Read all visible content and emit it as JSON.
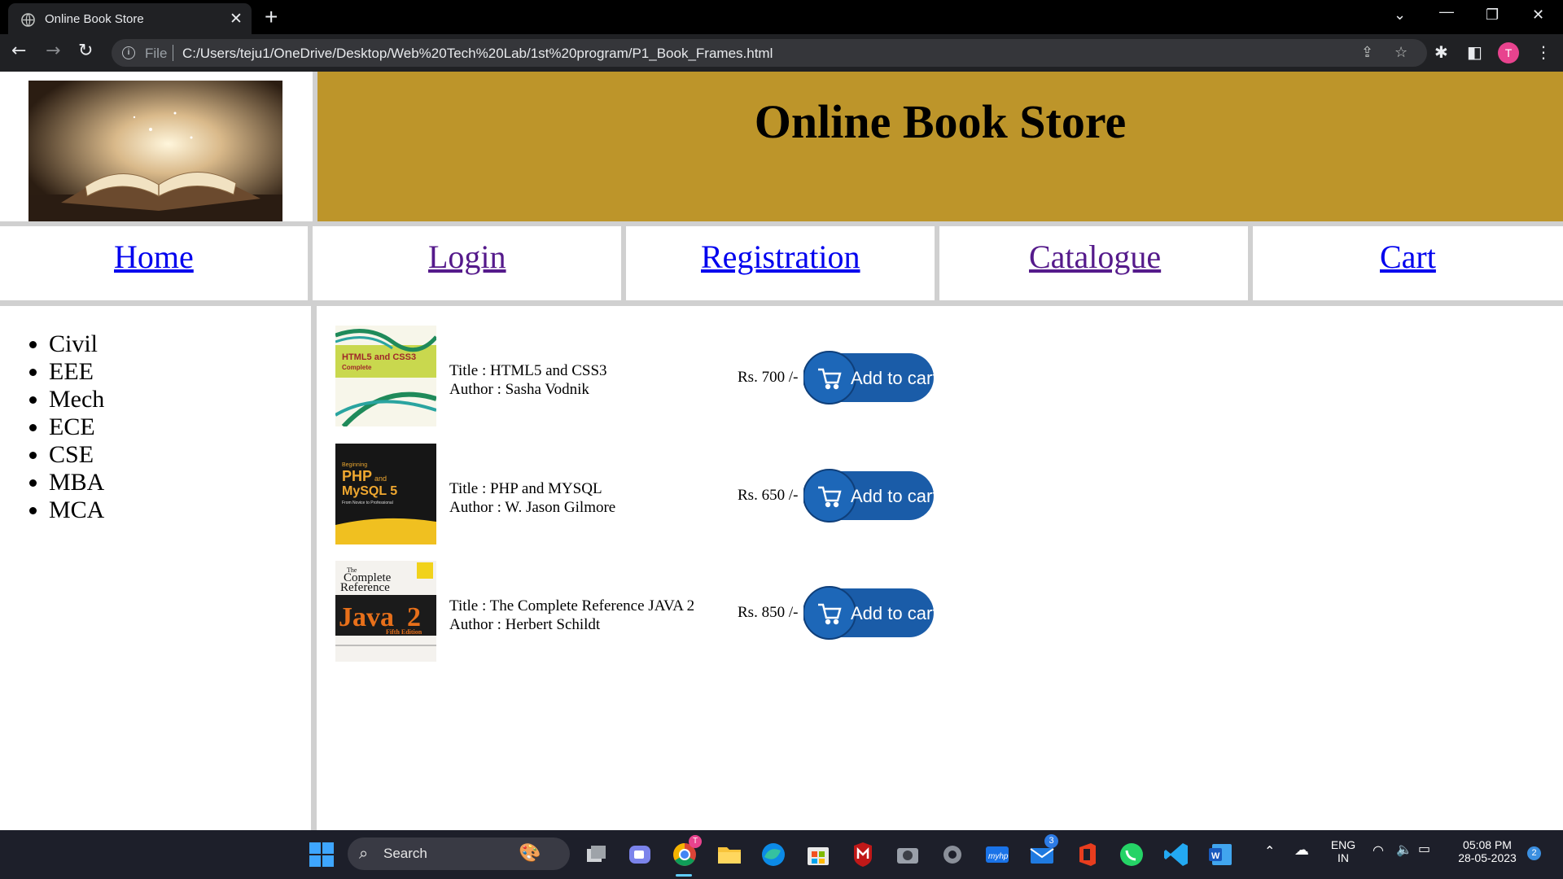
{
  "browser": {
    "tab_title": "Online Book Store",
    "file_label": "File",
    "url": "C:/Users/teju1/OneDrive/Desktop/Web%20Tech%20Lab/1st%20program/P1_Book_Frames.html",
    "profile_initial": "T"
  },
  "page": {
    "title": "Online Book Store",
    "nav": [
      "Home",
      "Login",
      "Registration",
      "Catalogue",
      "Cart"
    ],
    "departments": [
      "Civil",
      "EEE",
      "Mech",
      "ECE",
      "CSE",
      "MBA",
      "MCA"
    ],
    "books": [
      {
        "title": "Title : HTML5 and CSS3",
        "author": "Author : Sasha Vodnik",
        "price": "Rs. 700 /-",
        "cover_title": "HTML5 and CSS3",
        "cover_sub": "Complete"
      },
      {
        "title": "Title : PHP and MYSQL",
        "author": "Author : W. Jason Gilmore",
        "price": "Rs. 650 /-",
        "cover_line1": "Beginning",
        "cover_line2": "PHP",
        "cover_and": "and",
        "cover_line3": "MySQL 5",
        "cover_sub": "From Novice to Professional"
      },
      {
        "title": "Title : The Complete Reference JAVA 2",
        "author": "Author : Herbert Schildt",
        "price": "Rs. 850 /-",
        "cover_line1": "The",
        "cover_line2": "Complete",
        "cover_line3": "Reference",
        "cover_java": "Java",
        "cover_num": "2",
        "cover_edition": "Fifth Edition"
      }
    ],
    "add_to_cart_label": "Add to cart"
  },
  "taskbar": {
    "search_label": "Search",
    "lang_line1": "ENG",
    "lang_line2": "IN",
    "time": "05:08 PM",
    "date": "28-05-2023",
    "notification_count": "2",
    "mail_badge": "3",
    "chrome_badge": "T"
  },
  "colors": {
    "header_bg": "#bd952a",
    "link_unvisited": "#0000ee",
    "link_visited": "#551a8b",
    "cart_button": "#1a5ca8"
  }
}
